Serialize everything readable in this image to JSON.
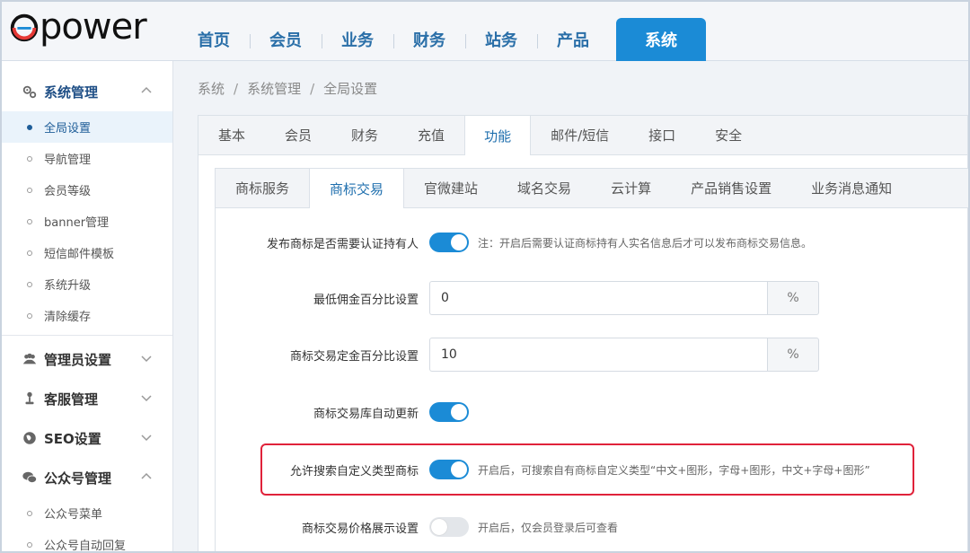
{
  "logo": {
    "text": "power"
  },
  "nav": {
    "items": [
      {
        "label": "首页"
      },
      {
        "label": "会员"
      },
      {
        "label": "业务"
      },
      {
        "label": "财务"
      },
      {
        "label": "站务"
      },
      {
        "label": "产品"
      }
    ],
    "active": {
      "label": "系统"
    }
  },
  "sidebar": {
    "group1": {
      "label": "系统管理",
      "icon": "gears-icon"
    },
    "group1_items": [
      {
        "label": "全局设置"
      },
      {
        "label": "导航管理"
      },
      {
        "label": "会员等级"
      },
      {
        "label": "banner管理"
      },
      {
        "label": "短信邮件模板"
      },
      {
        "label": "系统升级"
      },
      {
        "label": "清除缓存"
      }
    ],
    "group2": {
      "label": "管理员设置",
      "icon": "users-icon"
    },
    "group3": {
      "label": "客服管理",
      "icon": "headset-icon"
    },
    "group4": {
      "label": "SEO设置",
      "icon": "globe-icon"
    },
    "group5": {
      "label": "公众号管理",
      "icon": "wechat-icon"
    },
    "group5_items": [
      {
        "label": "公众号菜单"
      },
      {
        "label": "公众号自动回复"
      }
    ]
  },
  "breadcrumb": {
    "a": "系统",
    "b": "系统管理",
    "c": "全局设置",
    "sep": "/"
  },
  "tabs1": [
    "基本",
    "会员",
    "财务",
    "充值",
    "功能",
    "邮件/短信",
    "接口",
    "安全"
  ],
  "tabs2": [
    "商标服务",
    "商标交易",
    "官微建站",
    "域名交易",
    "云计算",
    "产品销售设置",
    "业务消息通知"
  ],
  "form": {
    "row1": {
      "label": "发布商标是否需要认证持有人",
      "toggle": "on",
      "note": "注：开启后需要认证商标持有人实名信息后才可以发布商标交易信息。"
    },
    "row2": {
      "label": "最低佣金百分比设置",
      "value": "0",
      "unit": "%"
    },
    "row3": {
      "label": "商标交易定金百分比设置",
      "value": "10",
      "unit": "%"
    },
    "row4": {
      "label": "商标交易库自动更新",
      "toggle": "on"
    },
    "row5": {
      "label": "允许搜索自定义类型商标",
      "toggle": "on",
      "note": "开启后，可搜索自有商标自定义类型“中文+图形，字母+图形，中文+字母+图形”"
    },
    "row6": {
      "label": "商标交易价格展示设置",
      "toggle": "off",
      "note": "开启后，仅会员登录后可查看"
    }
  },
  "colors": {
    "accent": "#1b8bd6",
    "highlight": "#e0223a"
  }
}
